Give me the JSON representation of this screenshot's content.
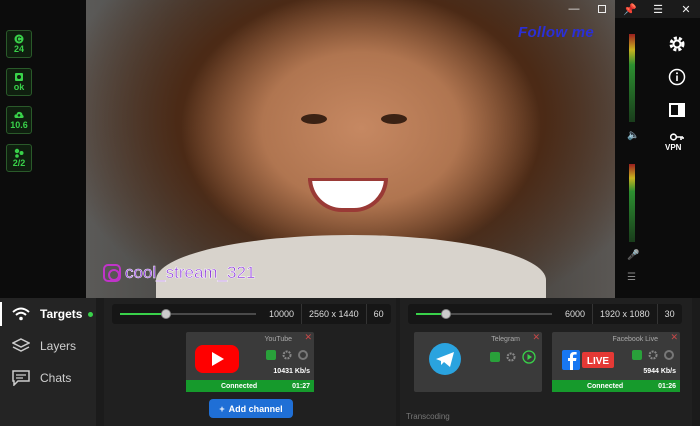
{
  "stats": [
    {
      "value": "24",
      "icon": "cpu-icon"
    },
    {
      "value": "ok",
      "icon": "gpu-icon"
    },
    {
      "value": "10.6",
      "icon": "cloud-upload-icon"
    },
    {
      "value": "2/2",
      "icon": "targets-connected-icon"
    }
  ],
  "preview": {
    "overlay_text": "Follow me",
    "watermark_text": "cool_stream_321"
  },
  "sidebar": {
    "vpn_label": "VPN"
  },
  "nav": [
    {
      "label": "Targets",
      "icon": "wifi-icon",
      "active": true
    },
    {
      "label": "Layers",
      "icon": "layers-icon",
      "active": false
    },
    {
      "label": "Chats",
      "icon": "chat-icon",
      "active": false
    }
  ],
  "groups": [
    {
      "bitrate": "10000",
      "resolution": "2560 x 1440",
      "fps": "60",
      "slider_fraction": 0.34
    },
    {
      "bitrate": "6000",
      "resolution": "1920 x 1080",
      "fps": "30",
      "slider_fraction": 0.22
    }
  ],
  "targets": [
    {
      "name": "YouTube",
      "rate": "10431 Kb/s",
      "status": "Connected",
      "time": "01:27"
    },
    {
      "name": "Telegram"
    },
    {
      "name": "Facebook Live",
      "rate": "5944 Kb/s",
      "status": "Connected",
      "time": "01:26"
    }
  ],
  "add_channel_label": "Add channel",
  "transcoding_label": "Transcoding",
  "live_badge": "LIVE",
  "colors": {
    "accent_green": "#39d24a",
    "youtube_red": "#ff0000",
    "telegram_blue": "#2aa3df",
    "facebook_blue": "#1877f2",
    "button_blue": "#1f6fd6"
  }
}
